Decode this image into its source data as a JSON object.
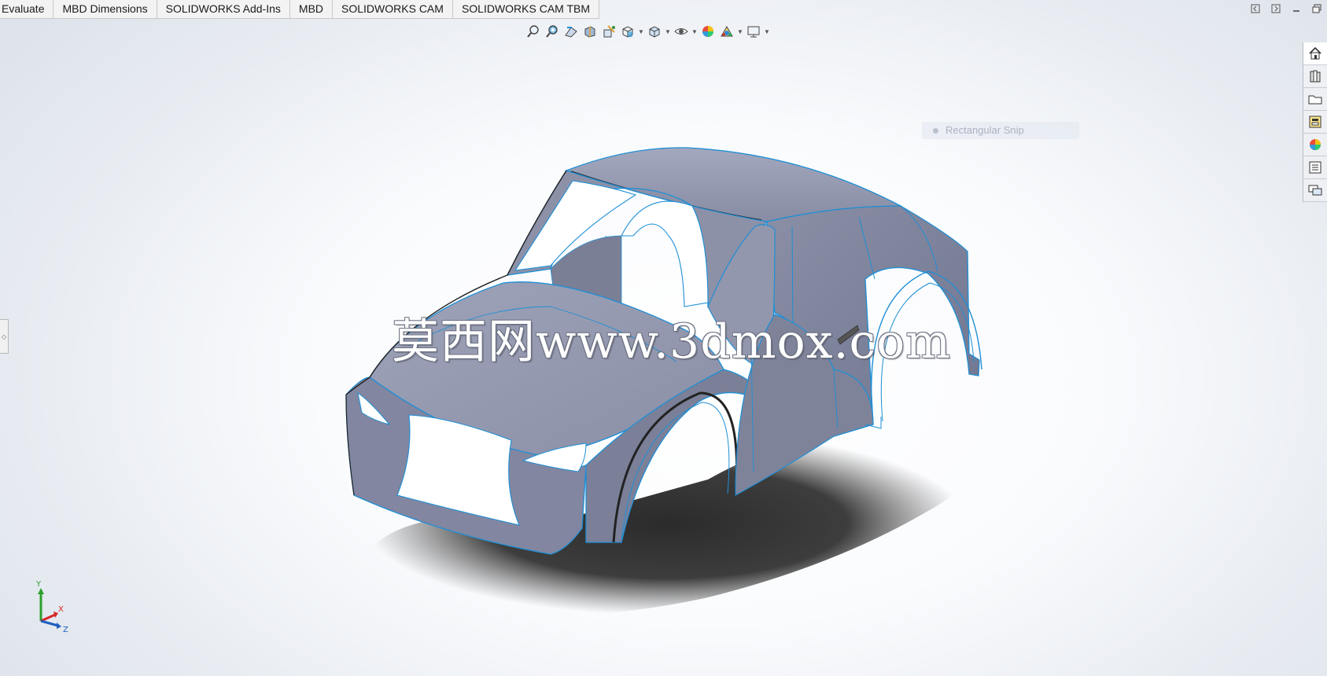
{
  "tabs": [
    "Evaluate",
    "MBD Dimensions",
    "SOLIDWORKS Add-Ins",
    "MBD",
    "SOLIDWORKS CAM",
    "SOLIDWORKS CAM TBM"
  ],
  "window_controls": [
    "restore-left-icon",
    "restore-right-icon",
    "minimize-icon",
    "maximize-icon"
  ],
  "view_toolbar": {
    "buttons": [
      "zoom-to-fit-icon",
      "zoom-to-area-icon",
      "previous-view-icon",
      "section-view-icon",
      "dynamic-annotation-views-icon",
      "view-orientation-icon",
      "display-style-icon",
      "hide-show-items-icon",
      "edit-appearance-icon",
      "apply-scene-icon",
      "view-settings-icon"
    ]
  },
  "task_pane": {
    "buttons": [
      "home-icon",
      "design-library-icon",
      "file-explorer-icon",
      "view-palette-icon",
      "appearances-icon",
      "custom-properties-icon",
      "forum-icon"
    ]
  },
  "ghost_tooltip": "Rectangular Snip",
  "watermark": "莫西网www.3dmox.com",
  "triad": {
    "y": "Y",
    "x": "X",
    "z": "Z"
  },
  "colors": {
    "body": "#8a8fa8",
    "edge": "#1e8fd6",
    "shadow": "#2b2b2b"
  }
}
